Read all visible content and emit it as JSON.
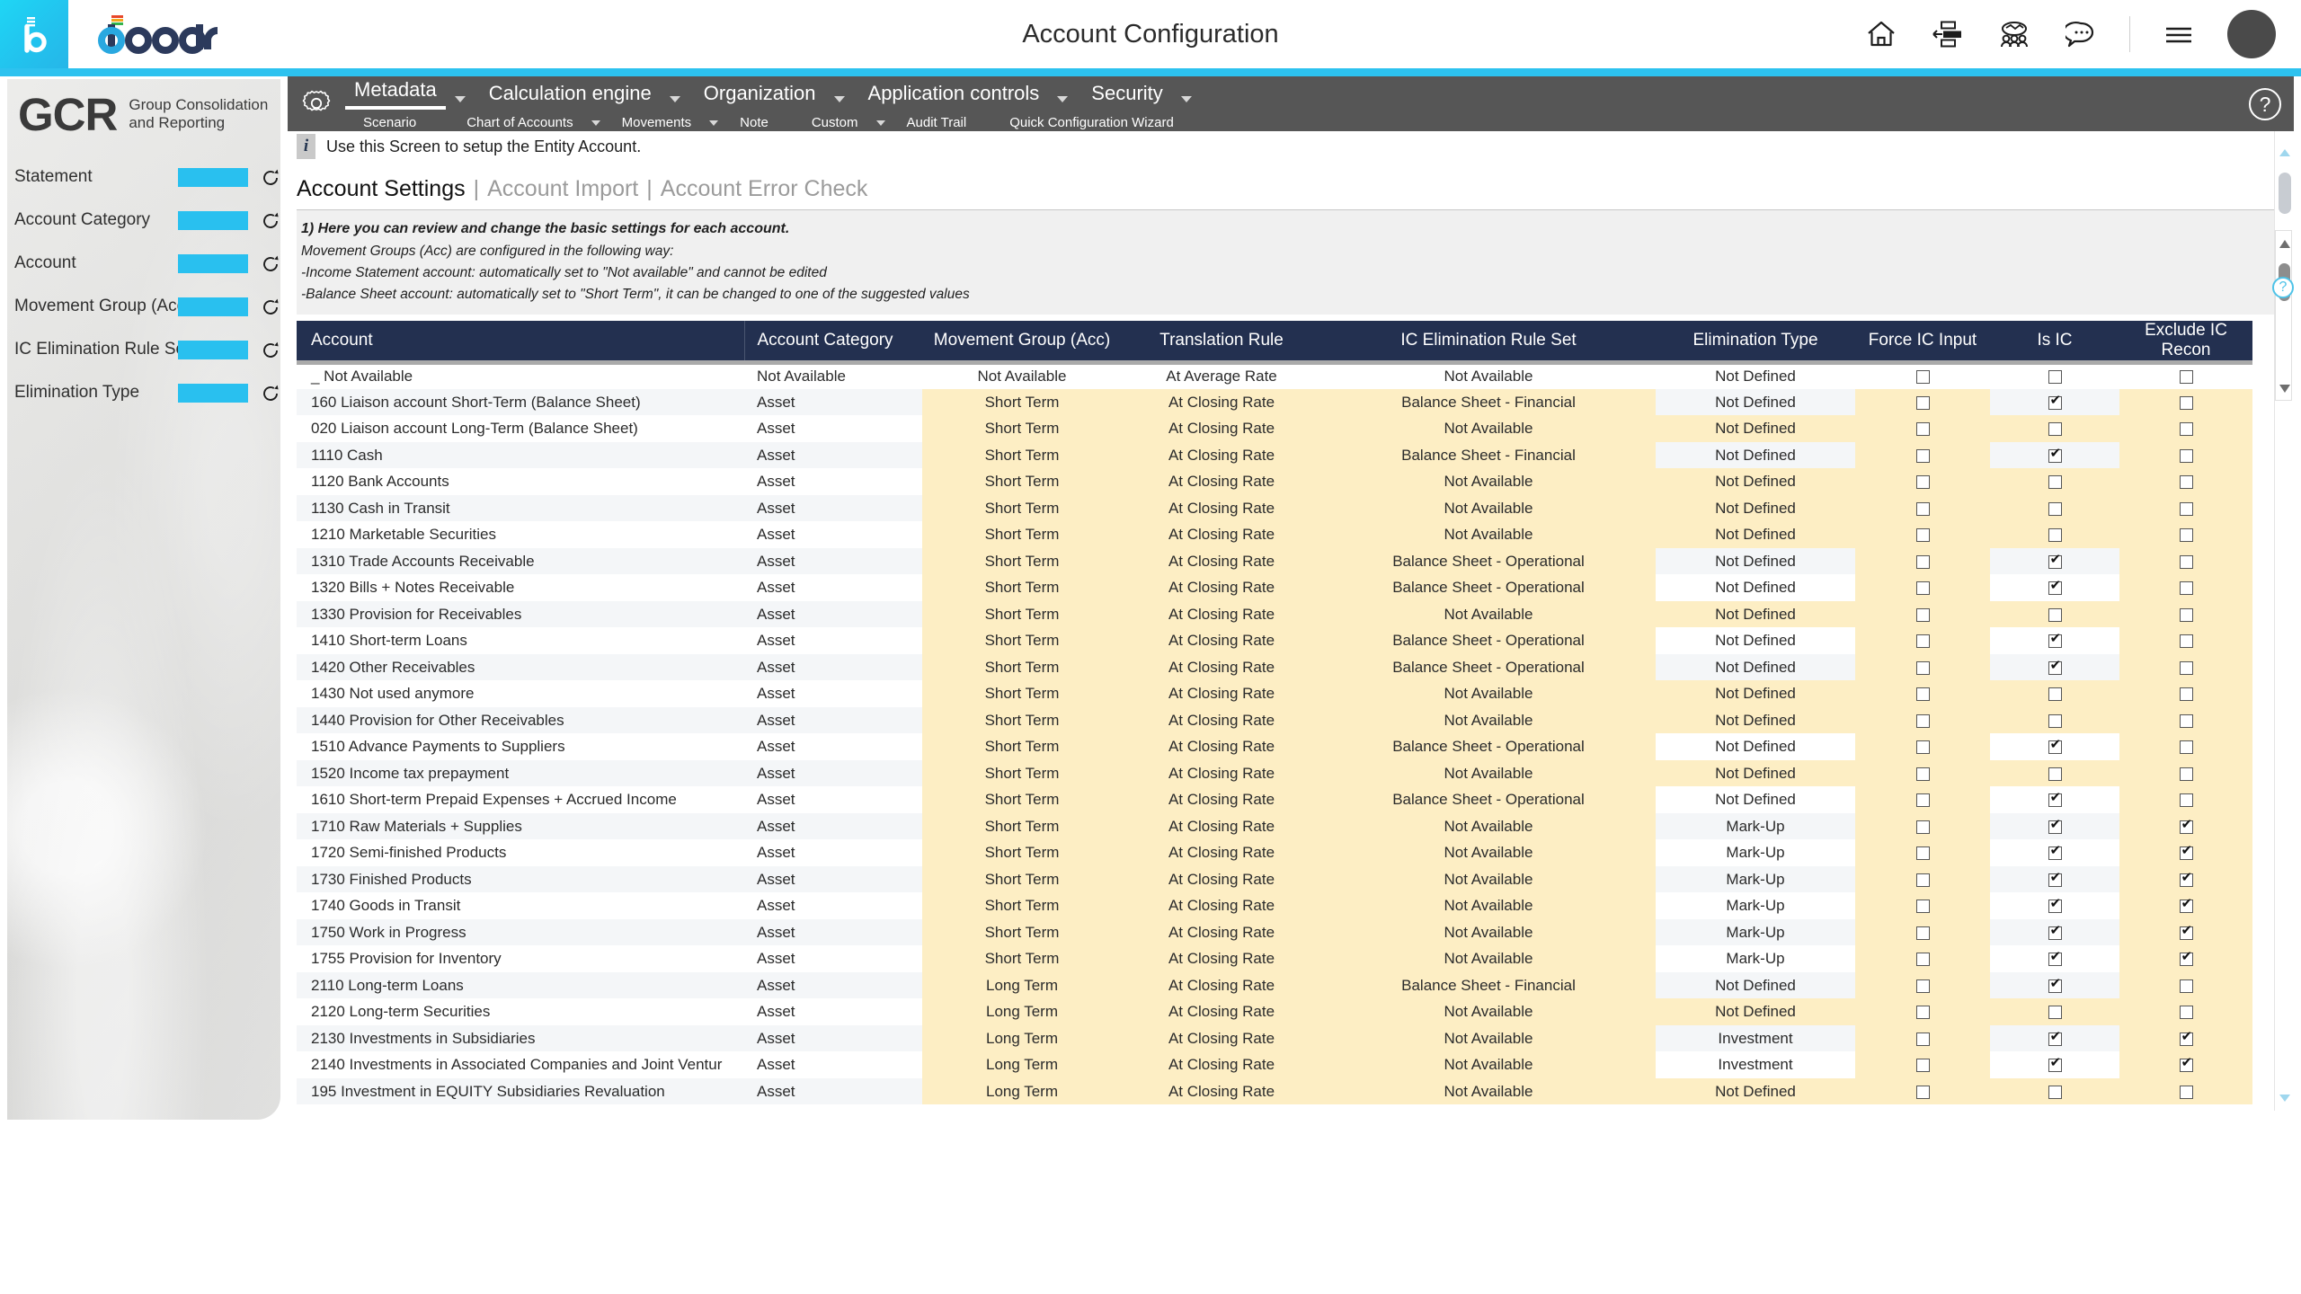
{
  "topbar": {
    "title": "Account Configuration",
    "icons": [
      {
        "name": "home-icon",
        "label": "Home"
      },
      {
        "name": "layout-icon",
        "label": "Layout"
      },
      {
        "name": "collaboration-icon",
        "label": "Collaboration"
      },
      {
        "name": "chat-icon",
        "label": "Chat"
      },
      {
        "name": "menu-icon",
        "label": "Menu"
      }
    ],
    "brand": "board",
    "avatar_label": "User"
  },
  "sidebar": {
    "logo_mark": "GCR",
    "logo_sub": "Group Consolidation and Reporting",
    "filters": [
      {
        "label": "Statement"
      },
      {
        "label": "Account Category"
      },
      {
        "label": "Account"
      },
      {
        "label": "Movement Group (Acc)"
      },
      {
        "label": "IC Elimination Rule Set"
      },
      {
        "label": "Elimination Type"
      }
    ]
  },
  "nav": {
    "main": [
      {
        "label": "Metadata",
        "active": true,
        "caret": true
      },
      {
        "label": "Calculation engine",
        "active": false,
        "caret": true
      },
      {
        "label": "Organization",
        "active": false,
        "caret": true
      },
      {
        "label": "Application controls",
        "active": false,
        "caret": true
      },
      {
        "label": "Security",
        "active": false,
        "caret": true
      }
    ],
    "sub": [
      {
        "label": "Scenario",
        "caret": false
      },
      {
        "label": "Chart of Accounts",
        "caret": true
      },
      {
        "label": "Movements",
        "caret": true
      },
      {
        "label": "Note",
        "caret": false
      },
      {
        "label": "Custom",
        "caret": true
      },
      {
        "label": "Audit Trail",
        "caret": false
      },
      {
        "label": "Quick Configuration Wizard",
        "caret": false
      }
    ],
    "help_label": "?"
  },
  "content": {
    "info_text": "Use this Screen to setup the Entity Account.",
    "tabs": {
      "active": "Account Settings",
      "second": "Account Import",
      "third": "Account Error Check",
      "separator": "|"
    },
    "notes": [
      "1) Here you can review and change the basic settings for each account.",
      "Movement Groups (Acc) are configured in the following way:",
      "-Income Statement account: automatically set to \"Not available\" and cannot be edited",
      "-Balance Sheet account: automatically set to \"Short Term\", it can be changed to one of the suggested values"
    ]
  },
  "table": {
    "columns": [
      "Account",
      "Account Category",
      "Movement Group (Acc)",
      "Translation Rule",
      "IC Elimination Rule Set",
      "Elimination Type",
      "Force IC Input",
      "Is IC",
      "Exclude IC Recon"
    ],
    "rows": [
      {
        "account": "_ Not Available",
        "category": "Not Available",
        "movement": "Not Available",
        "translation": "At Average Rate",
        "ruleset": "Not Available",
        "elimination": "Not Defined",
        "force_ic": false,
        "is_ic": false,
        "exclude_ic": false,
        "highlight": false
      },
      {
        "account": "160 Liaison account Short-Term (Balance Sheet)",
        "category": "Asset",
        "movement": "Short Term",
        "translation": "At Closing Rate",
        "ruleset": "Balance Sheet - Financial",
        "elimination": "Not Defined",
        "force_ic": false,
        "is_ic": true,
        "exclude_ic": false,
        "highlight": true
      },
      {
        "account": "020 Liaison account Long-Term (Balance Sheet)",
        "category": "Asset",
        "movement": "Short Term",
        "translation": "At Closing Rate",
        "ruleset": "Not Available",
        "elimination": "Not Defined",
        "force_ic": false,
        "is_ic": false,
        "exclude_ic": false,
        "highlight": true
      },
      {
        "account": "1110 Cash",
        "category": "Asset",
        "movement": "Short Term",
        "translation": "At Closing Rate",
        "ruleset": "Balance Sheet - Financial",
        "elimination": "Not Defined",
        "force_ic": false,
        "is_ic": true,
        "exclude_ic": false,
        "highlight": true
      },
      {
        "account": "1120 Bank Accounts",
        "category": "Asset",
        "movement": "Short Term",
        "translation": "At Closing Rate",
        "ruleset": "Not Available",
        "elimination": "Not Defined",
        "force_ic": false,
        "is_ic": false,
        "exclude_ic": false,
        "highlight": true
      },
      {
        "account": "1130 Cash in Transit",
        "category": "Asset",
        "movement": "Short Term",
        "translation": "At Closing Rate",
        "ruleset": "Not Available",
        "elimination": "Not Defined",
        "force_ic": false,
        "is_ic": false,
        "exclude_ic": false,
        "highlight": true
      },
      {
        "account": "1210 Marketable Securities",
        "category": "Asset",
        "movement": "Short Term",
        "translation": "At Closing Rate",
        "ruleset": "Not Available",
        "elimination": "Not Defined",
        "force_ic": false,
        "is_ic": false,
        "exclude_ic": false,
        "highlight": true
      },
      {
        "account": "1310 Trade Accounts Receivable",
        "category": "Asset",
        "movement": "Short Term",
        "translation": "At Closing Rate",
        "ruleset": "Balance Sheet - Operational",
        "elimination": "Not Defined",
        "force_ic": false,
        "is_ic": true,
        "exclude_ic": false,
        "highlight": true
      },
      {
        "account": "1320 Bills + Notes Receivable",
        "category": "Asset",
        "movement": "Short Term",
        "translation": "At Closing Rate",
        "ruleset": "Balance Sheet - Operational",
        "elimination": "Not Defined",
        "force_ic": false,
        "is_ic": true,
        "exclude_ic": false,
        "highlight": true
      },
      {
        "account": "1330 Provision for Receivables",
        "category": "Asset",
        "movement": "Short Term",
        "translation": "At Closing Rate",
        "ruleset": "Not Available",
        "elimination": "Not Defined",
        "force_ic": false,
        "is_ic": false,
        "exclude_ic": false,
        "highlight": true
      },
      {
        "account": "1410 Short-term Loans",
        "category": "Asset",
        "movement": "Short Term",
        "translation": "At Closing Rate",
        "ruleset": "Balance Sheet - Operational",
        "elimination": "Not Defined",
        "force_ic": false,
        "is_ic": true,
        "exclude_ic": false,
        "highlight": true
      },
      {
        "account": "1420 Other Receivables",
        "category": "Asset",
        "movement": "Short Term",
        "translation": "At Closing Rate",
        "ruleset": "Balance Sheet - Operational",
        "elimination": "Not Defined",
        "force_ic": false,
        "is_ic": true,
        "exclude_ic": false,
        "highlight": true
      },
      {
        "account": "1430 Not used anymore",
        "category": "Asset",
        "movement": "Short Term",
        "translation": "At Closing Rate",
        "ruleset": "Not Available",
        "elimination": "Not Defined",
        "force_ic": false,
        "is_ic": false,
        "exclude_ic": false,
        "highlight": true
      },
      {
        "account": "1440 Provision for Other Receivables",
        "category": "Asset",
        "movement": "Short Term",
        "translation": "At Closing Rate",
        "ruleset": "Not Available",
        "elimination": "Not Defined",
        "force_ic": false,
        "is_ic": false,
        "exclude_ic": false,
        "highlight": true
      },
      {
        "account": "1510 Advance Payments to Suppliers",
        "category": "Asset",
        "movement": "Short Term",
        "translation": "At Closing Rate",
        "ruleset": "Balance Sheet - Operational",
        "elimination": "Not Defined",
        "force_ic": false,
        "is_ic": true,
        "exclude_ic": false,
        "highlight": true
      },
      {
        "account": "1520 Income tax prepayment",
        "category": "Asset",
        "movement": "Short Term",
        "translation": "At Closing Rate",
        "ruleset": "Not Available",
        "elimination": "Not Defined",
        "force_ic": false,
        "is_ic": false,
        "exclude_ic": false,
        "highlight": true
      },
      {
        "account": "1610 Short-term Prepaid Expenses + Accrued Income",
        "category": "Asset",
        "movement": "Short Term",
        "translation": "At Closing Rate",
        "ruleset": "Balance Sheet - Operational",
        "elimination": "Not Defined",
        "force_ic": false,
        "is_ic": true,
        "exclude_ic": false,
        "highlight": true
      },
      {
        "account": "1710 Raw Materials + Supplies",
        "category": "Asset",
        "movement": "Short Term",
        "translation": "At Closing Rate",
        "ruleset": "Not Available",
        "elimination": "Mark-Up",
        "force_ic": false,
        "is_ic": true,
        "exclude_ic": true,
        "highlight": true
      },
      {
        "account": "1720 Semi-finished Products",
        "category": "Asset",
        "movement": "Short Term",
        "translation": "At Closing Rate",
        "ruleset": "Not Available",
        "elimination": "Mark-Up",
        "force_ic": false,
        "is_ic": true,
        "exclude_ic": true,
        "highlight": true
      },
      {
        "account": "1730 Finished Products",
        "category": "Asset",
        "movement": "Short Term",
        "translation": "At Closing Rate",
        "ruleset": "Not Available",
        "elimination": "Mark-Up",
        "force_ic": false,
        "is_ic": true,
        "exclude_ic": true,
        "highlight": true
      },
      {
        "account": "1740 Goods in Transit",
        "category": "Asset",
        "movement": "Short Term",
        "translation": "At Closing Rate",
        "ruleset": "Not Available",
        "elimination": "Mark-Up",
        "force_ic": false,
        "is_ic": true,
        "exclude_ic": true,
        "highlight": true
      },
      {
        "account": "1750 Work in Progress",
        "category": "Asset",
        "movement": "Short Term",
        "translation": "At Closing Rate",
        "ruleset": "Not Available",
        "elimination": "Mark-Up",
        "force_ic": false,
        "is_ic": true,
        "exclude_ic": true,
        "highlight": true
      },
      {
        "account": "1755 Provision for Inventory",
        "category": "Asset",
        "movement": "Short Term",
        "translation": "At Closing Rate",
        "ruleset": "Not Available",
        "elimination": "Mark-Up",
        "force_ic": false,
        "is_ic": true,
        "exclude_ic": true,
        "highlight": true
      },
      {
        "account": "2110 Long-term Loans",
        "category": "Asset",
        "movement": "Long Term",
        "translation": "At Closing Rate",
        "ruleset": "Balance Sheet - Financial",
        "elimination": "Not Defined",
        "force_ic": false,
        "is_ic": true,
        "exclude_ic": false,
        "highlight": true
      },
      {
        "account": "2120 Long-term Securities",
        "category": "Asset",
        "movement": "Long Term",
        "translation": "At Closing Rate",
        "ruleset": "Not Available",
        "elimination": "Not Defined",
        "force_ic": false,
        "is_ic": false,
        "exclude_ic": false,
        "highlight": true
      },
      {
        "account": "2130 Investments in Subsidiaries",
        "category": "Asset",
        "movement": "Long Term",
        "translation": "At Closing Rate",
        "ruleset": "Not Available",
        "elimination": "Investment",
        "force_ic": false,
        "is_ic": true,
        "exclude_ic": true,
        "highlight": true
      },
      {
        "account": "2140 Investments in Associated Companies and Joint Ventur",
        "category": "Asset",
        "movement": "Long Term",
        "translation": "At Closing Rate",
        "ruleset": "Not Available",
        "elimination": "Investment",
        "force_ic": false,
        "is_ic": true,
        "exclude_ic": true,
        "highlight": true
      },
      {
        "account": "195 Investment in EQUITY Subsidiaries Revaluation",
        "category": "Asset",
        "movement": "Long Term",
        "translation": "At Closing Rate",
        "ruleset": "Not Available",
        "elimination": "Not Defined",
        "force_ic": false,
        "is_ic": false,
        "exclude_ic": false,
        "highlight": true
      }
    ]
  },
  "misc": {
    "mini_help_label": "?"
  },
  "colors": {
    "accent": "#2dc2ef",
    "header_navy": "#233050",
    "highlight_yellow": "#fdeec4",
    "nav_gray": "#565656"
  }
}
